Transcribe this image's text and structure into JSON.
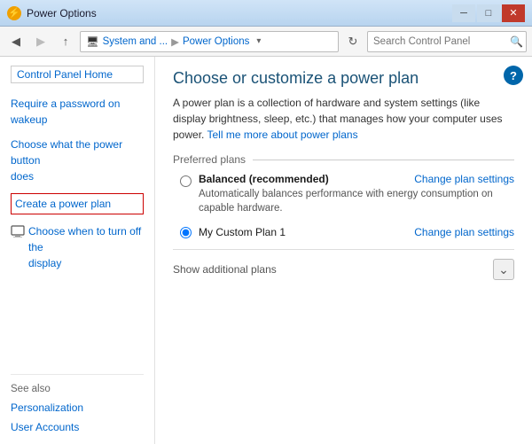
{
  "titlebar": {
    "icon": "⚡",
    "title": "Power Options",
    "minimize_label": "─",
    "maximize_label": "□",
    "close_label": "✕"
  },
  "navbar": {
    "back_label": "◀",
    "forward_label": "▶",
    "up_label": "↑",
    "breadcrumb_part1": "System and ...",
    "breadcrumb_sep1": "▶",
    "breadcrumb_part2": "Power Options",
    "refresh_label": "↻",
    "search_placeholder": "Search Control Panel"
  },
  "sidebar": {
    "home_link": "Control Panel Home",
    "link1_line1": "Require a password on wakeup",
    "link2_line1": "Choose what the power button",
    "link2_line2": "does",
    "link3": "Create a power plan",
    "link4_line1": "Choose when to turn off the",
    "link4_line2": "display",
    "see_also_label": "See also",
    "see_also_link1": "Personalization",
    "see_also_link2": "User Accounts"
  },
  "content": {
    "title": "Choose or customize a power plan",
    "description_p1": "A power plan is a collection of hardware and system settings (like display brightness, sleep, etc.) that manages how your computer uses power. ",
    "description_link": "Tell me more about power plans",
    "preferred_label": "Preferred plans",
    "plan1_name": "Balanced (recommended)",
    "plan1_desc": "Automatically balances performance with energy consumption on capable hardware.",
    "plan1_change": "Change plan settings",
    "plan2_name": "My Custom Plan 1",
    "plan2_change": "Change plan settings",
    "show_additional": "Show additional plans",
    "help_label": "?"
  }
}
